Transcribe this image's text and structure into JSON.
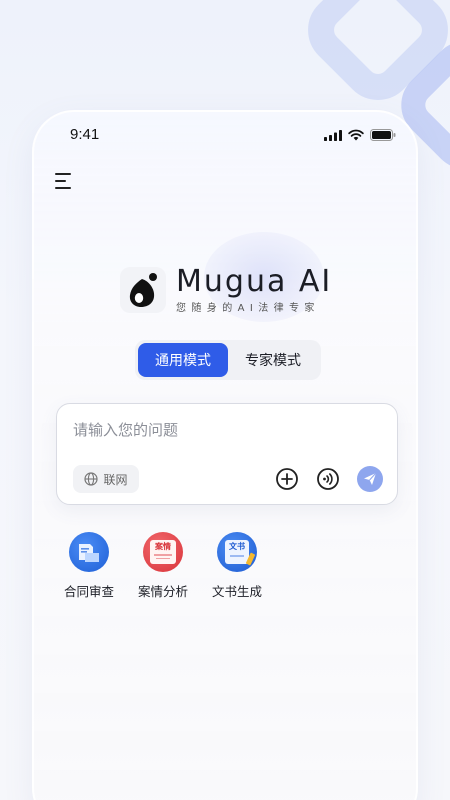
{
  "status": {
    "time": "9:41"
  },
  "brand": {
    "name": "Mugua AI",
    "slogan": "您随身的AI法律专家"
  },
  "modes": [
    {
      "label": "通用模式",
      "active": true
    },
    {
      "label": "专家模式",
      "active": false
    }
  ],
  "input": {
    "placeholder": "请输入您的问题",
    "value": ""
  },
  "web_toggle": {
    "label": "联网"
  },
  "features": [
    {
      "label": "合同审查",
      "icon": "contract-document-icon",
      "badge": ""
    },
    {
      "label": "案情分析",
      "icon": "case-analysis-icon",
      "badge": "案情"
    },
    {
      "label": "文书生成",
      "icon": "document-generate-icon",
      "badge": "文书"
    }
  ],
  "colors": {
    "accent": "#2f5ce8",
    "send": "#8ea6ee",
    "case_red": "#e2454a"
  }
}
